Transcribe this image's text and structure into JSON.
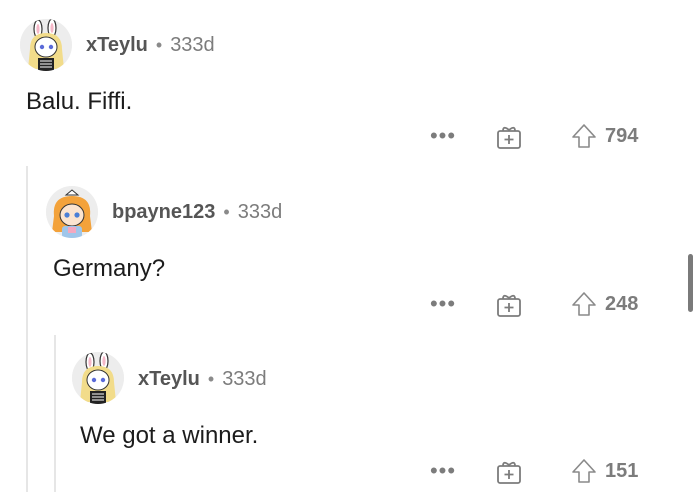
{
  "comments": [
    {
      "author": "xTeylu",
      "separator": "•",
      "age": "333d",
      "text": "Balu. Fiffi.",
      "score": "794",
      "avatar_icon": "bunny-girl-avatar-icon"
    },
    {
      "author": "bpayne123",
      "separator": "•",
      "age": "333d",
      "text": "Germany?",
      "score": "248",
      "avatar_icon": "orange-hair-girl-avatar-icon"
    },
    {
      "author": "xTeylu",
      "separator": "•",
      "age": "333d",
      "text": "We got a winner.",
      "score": "151",
      "avatar_icon": "bunny-girl-avatar-icon"
    }
  ],
  "actions": {
    "more_label": "•••",
    "award_icon": "gift-award-icon",
    "upvote_icon": "upvote-arrow-icon"
  },
  "colors": {
    "text": "#1c1c1c",
    "meta": "#7c7c7c",
    "thread_line": "#e6e6e6"
  }
}
